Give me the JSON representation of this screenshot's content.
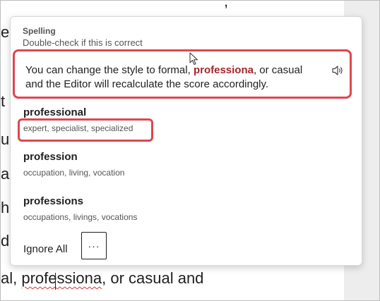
{
  "document": {
    "fragments": [
      {
        "text": ","
      },
      {
        "text": "e"
      },
      {
        "text": "u"
      },
      {
        "text": "a"
      },
      {
        "text": "h"
      },
      {
        "text": "d"
      },
      {
        "text": "t"
      }
    ],
    "bottom_line": {
      "before": "al, ",
      "flagged": "professiona",
      "after": ", or casual and"
    }
  },
  "editor_pane": {
    "category": "Spelling",
    "subtitle": "Double-check if this is correct",
    "context": {
      "before": "You can change the style to formal, ",
      "flagged": "professiona",
      "after": ", or casual and the Editor will recalculate the score accordingly."
    },
    "read_aloud_icon": "speaker-icon",
    "suggestions": [
      {
        "word": "professional",
        "synonyms": "expert, specialist, specialized"
      },
      {
        "word": "profession",
        "synonyms": "occupation, living, vocation"
      },
      {
        "word": "professions",
        "synonyms": "occupations, livings, vocations"
      }
    ],
    "ignore_all_label": "Ignore All",
    "more_options_label": "···"
  },
  "colors": {
    "flagged_word": "#a4262c",
    "highlight_box": "#e0464f",
    "squiggle": "#d13438"
  }
}
